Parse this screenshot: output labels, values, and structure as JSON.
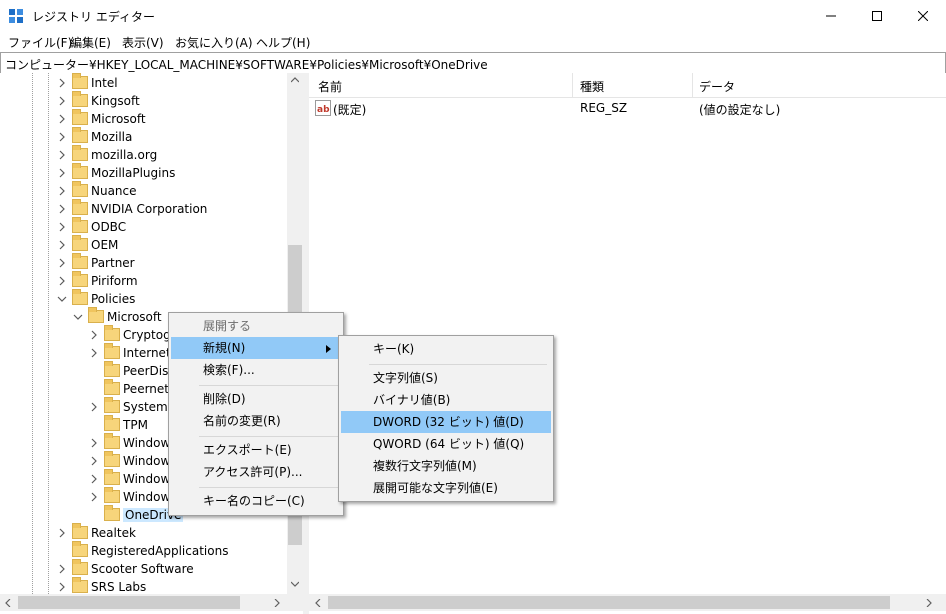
{
  "window": {
    "title": "レジストリ エディター"
  },
  "menubar": {
    "items": [
      "ファイル(F)",
      "編集(E)",
      "表示(V)",
      "お気に入り(A)",
      "ヘルプ(H)"
    ]
  },
  "address": {
    "path": "コンピューター¥HKEY_LOCAL_MACHINE¥SOFTWARE¥Policies¥Microsoft¥OneDrive"
  },
  "tree": {
    "level1": [
      "Intel",
      "Kingsoft",
      "Microsoft",
      "Mozilla",
      "mozilla.org",
      "MozillaPlugins",
      "Nuance",
      "NVIDIA Corporation",
      "ODBC",
      "OEM",
      "Partner",
      "Piriform",
      "Policies"
    ],
    "policies_child": "Microsoft",
    "microsoft_children": [
      "Cryptography",
      "Internet Explorer",
      "PeerDist",
      "Peernet",
      "SystemCertificates",
      "TPM",
      "Windows",
      "Windows Advanced Threat Protection",
      "Windows Defender",
      "Windows NT",
      "OneDrive"
    ],
    "level1_after": [
      "Realtek",
      "RegisteredApplications",
      "Scooter Software",
      "SRS Labs"
    ]
  },
  "list": {
    "headers": {
      "name": "名前",
      "type": "種類",
      "data": "データ"
    },
    "rows": [
      {
        "name": "(既定)",
        "type": "REG_SZ",
        "data": "(値の設定なし)"
      }
    ]
  },
  "context_menu": {
    "expand": "展開する",
    "new": "新規(N)",
    "find": "検索(F)...",
    "delete": "削除(D)",
    "rename": "名前の変更(R)",
    "export": "エクスポート(E)",
    "permissions": "アクセス許可(P)...",
    "copy_key_name": "キー名のコピー(C)"
  },
  "submenu": {
    "key": "キー(K)",
    "string": "文字列値(S)",
    "binary": "バイナリ値(B)",
    "dword": "DWORD (32 ビット) 値(D)",
    "qword": "QWORD (64 ビット) 値(Q)",
    "multi_string": "複数行文字列値(M)",
    "expandable_string": "展開可能な文字列値(E)"
  },
  "colors": {
    "highlight": "#91c9f7",
    "folder": "#f7d57b",
    "menu_bg": "#f2f2f2"
  }
}
